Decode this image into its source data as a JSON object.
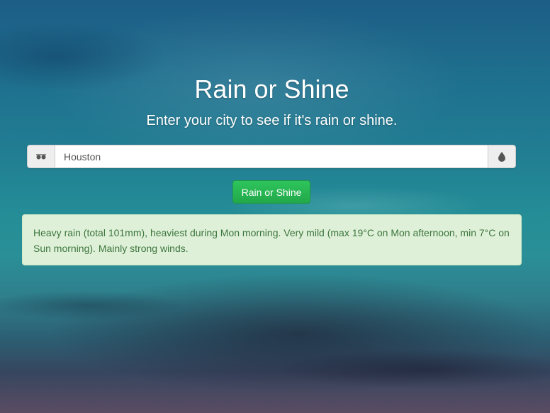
{
  "header": {
    "title": "Rain or Shine",
    "subtitle": "Enter your city to see if it's rain or shine."
  },
  "search": {
    "value": "Houston",
    "left_icon": "sunglasses-icon",
    "right_icon": "raindrop-icon"
  },
  "submit": {
    "label": "Rain or Shine"
  },
  "result": {
    "text": "Heavy rain (total 101mm), heaviest during Mon morning. Very mild (max 19°C on Mon afternoon, min 7°C on Sun morning). Mainly strong winds."
  },
  "colors": {
    "button": "#22a84a",
    "alert_bg": "#dff0d8",
    "alert_text": "#3c763d"
  }
}
